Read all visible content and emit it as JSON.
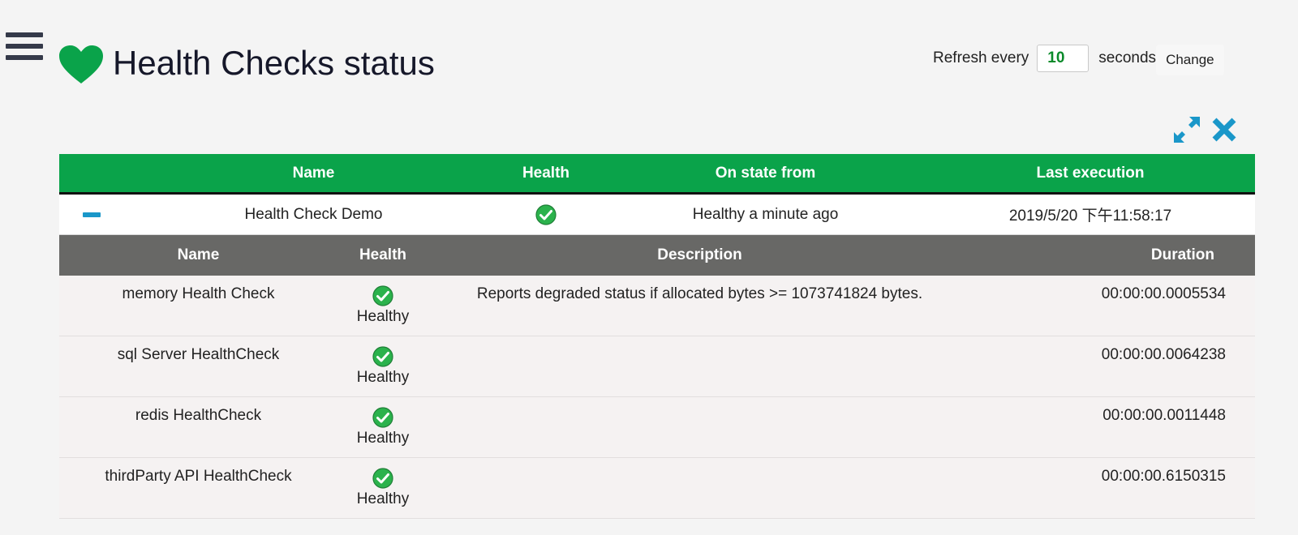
{
  "header": {
    "title": "Health Checks status",
    "heart_color": "#0aa34a"
  },
  "refresh": {
    "label_before": "Refresh every",
    "value": "10",
    "label_after": "seconds",
    "button_label": "Change"
  },
  "toolbar": {
    "expand_icon": "expand-arrows-icon",
    "close_icon": "close-x-icon",
    "icon_color": "#1a97c9"
  },
  "table": {
    "columns": [
      "Name",
      "Health",
      "On state from",
      "Last execution"
    ],
    "rows": [
      {
        "name": "Health Check Demo",
        "health": "check-icon",
        "state": "Healthy a minute ago",
        "last_execution": "2019/5/20 下午11:58:17",
        "details": {
          "columns": [
            "Name",
            "Health",
            "Description",
            "Duration"
          ],
          "entries": [
            {
              "name": "memory Health Check",
              "health": "Healthy",
              "description": "Reports degraded status if allocated bytes >= 1073741824 bytes.",
              "duration": "00:00:00.0005534"
            },
            {
              "name": "sql Server HealthCheck",
              "health": "Healthy",
              "description": "",
              "duration": "00:00:00.0064238"
            },
            {
              "name": "redis HealthCheck",
              "health": "Healthy",
              "description": "",
              "duration": "00:00:00.0011448"
            },
            {
              "name": "thirdParty API HealthCheck",
              "health": "Healthy",
              "description": "",
              "duration": "00:00:00.6150315"
            }
          ]
        }
      }
    ]
  },
  "colors": {
    "header_green": "#0aa34a",
    "sub_header_gray": "#686866",
    "check_green": "#2bb24c"
  }
}
